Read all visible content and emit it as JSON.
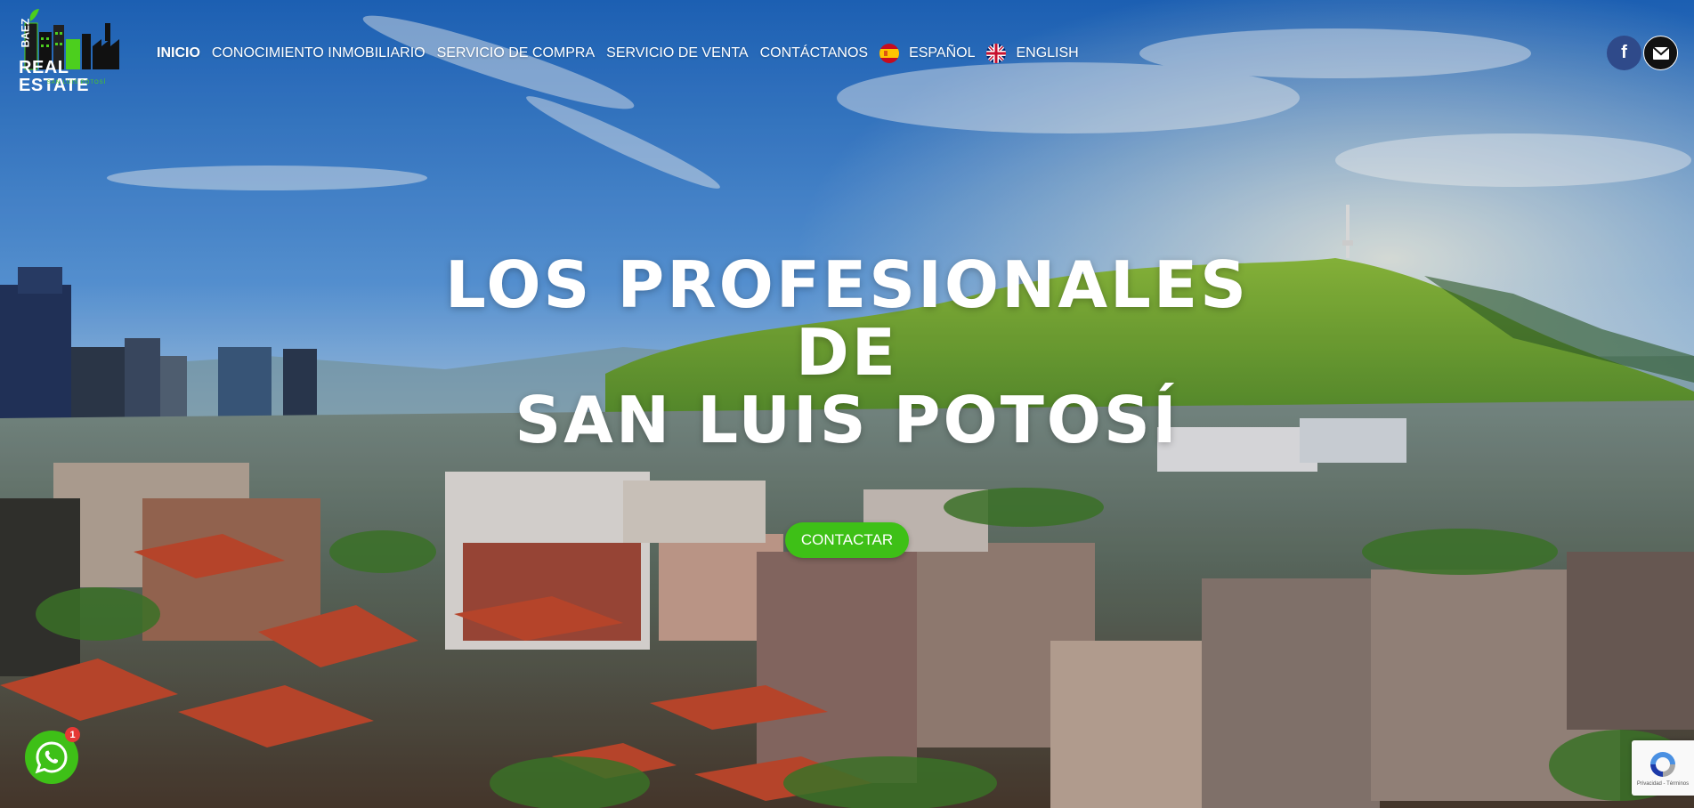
{
  "logo": {
    "brand_vertical": "BAEZ",
    "brand_name": "REAL ESTATE",
    "brand_sub": "SAN LUIS POTOSÍ"
  },
  "nav": {
    "items": [
      {
        "label": "INICIO",
        "active": true
      },
      {
        "label": "CONOCIMIENTO INMOBILIARIO"
      },
      {
        "label": "SERVICIO DE COMPRA"
      },
      {
        "label": "SERVICIO DE VENTA"
      },
      {
        "label": "CONTÁCTANOS"
      },
      {
        "label": "ESPAÑOL",
        "icon": "spain-flag-icon"
      },
      {
        "label": "ENGLISH",
        "icon": "uk-flag-icon"
      }
    ]
  },
  "social": {
    "facebook_icon": "facebook-icon",
    "facebook_glyph": "f",
    "mail_icon": "mail-icon"
  },
  "hero": {
    "line1": "LOS PROFESIONALES",
    "line2": "DE",
    "line3": "SAN LUIS POTOSÍ",
    "cta_label": "CONTACTAR"
  },
  "whatsapp": {
    "icon": "whatsapp-icon",
    "badge_count": "1"
  },
  "recaptcha": {
    "icon": "recaptcha-icon",
    "text": "Privacidad - Términos"
  },
  "colors": {
    "accent_green": "#3ec017",
    "facebook_blue": "#2f4a8a",
    "badge_red": "#e53935"
  }
}
